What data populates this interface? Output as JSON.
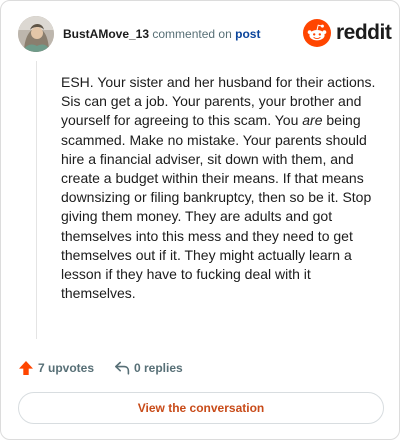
{
  "comment": {
    "author": "BustAMove_13",
    "commented_on": "commented on",
    "post_link": "post",
    "body_before": "ESH. Your sister and her husband for their actions. Sis can get a job. Your parents, your brother and yourself for agreeing to this scam. You ",
    "body_em": "are",
    "body_after": " being scammed. Make no mistake. Your parents should hire a financial adviser, sit down with them, and create a budget within their means. If that means downsizing or filing bankruptcy, then so be it. Stop giving them money. They are adults and got themselves into this mess and they need to get themselves out if it. They might actually learn a lesson if they have to fucking deal with it themselves.",
    "upvotes": "7 upvotes",
    "replies": "0 replies"
  },
  "brand": {
    "wordmark": "reddit",
    "logo_icon": "reddit-snoo-icon",
    "accent": "#ff4500"
  },
  "cta": {
    "label": "View the conversation"
  },
  "icons": {
    "upvote": "upvote-arrow-icon",
    "reply": "reply-arrow-icon",
    "avatar": "user-avatar"
  },
  "colors": {
    "username": "#1c1c1c",
    "meta": "#576f76",
    "link": "#0a449b",
    "upvote": "#ff4500",
    "cta_text": "#c84b19"
  }
}
